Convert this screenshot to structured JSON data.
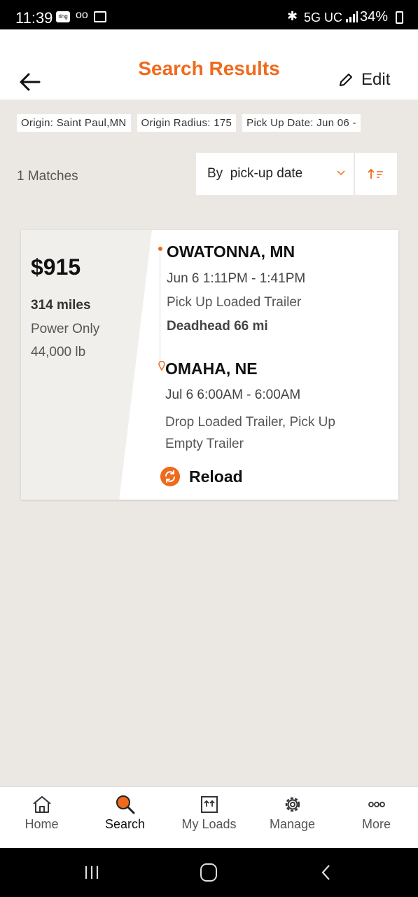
{
  "status_bar": {
    "time": "11:39",
    "ring": "ring",
    "voicemail": "oo",
    "network": "5G UC",
    "battery": "34%"
  },
  "header": {
    "title": "Search Results",
    "edit_label": "Edit"
  },
  "filters": [
    {
      "label": "Origin: Saint Paul,MN"
    },
    {
      "label": "Origin Radius: 175"
    },
    {
      "label": "Pick Up Date: Jun 06 -"
    }
  ],
  "results": {
    "count_label": "1 Matches",
    "sort_label": "By  pick-up date"
  },
  "load": {
    "price": "$915",
    "miles": "314 miles",
    "equipment": "Power Only",
    "weight": "44,000 lb",
    "origin": {
      "city": "OWATONNA, MN",
      "time": "Jun 6 1:11PM - 1:41PM",
      "activity": "Pick Up Loaded Trailer",
      "deadhead": "Deadhead 66 mi"
    },
    "destination": {
      "city": "OMAHA, NE",
      "time": "Jul 6 6:00AM - 6:00AM",
      "activity": "Drop Loaded Trailer, Pick Up Empty Trailer"
    },
    "tag": "Reload"
  },
  "bottom_nav": [
    {
      "label": "Home",
      "icon": "home-icon"
    },
    {
      "label": "Search",
      "icon": "search-icon",
      "active": true
    },
    {
      "label": "My Loads",
      "icon": "my-loads-icon"
    },
    {
      "label": "Manage",
      "icon": "gear-icon"
    },
    {
      "label": "More",
      "icon": "more-icon"
    }
  ],
  "colors": {
    "accent": "#ef6a1c",
    "background": "#ebe8e3"
  }
}
